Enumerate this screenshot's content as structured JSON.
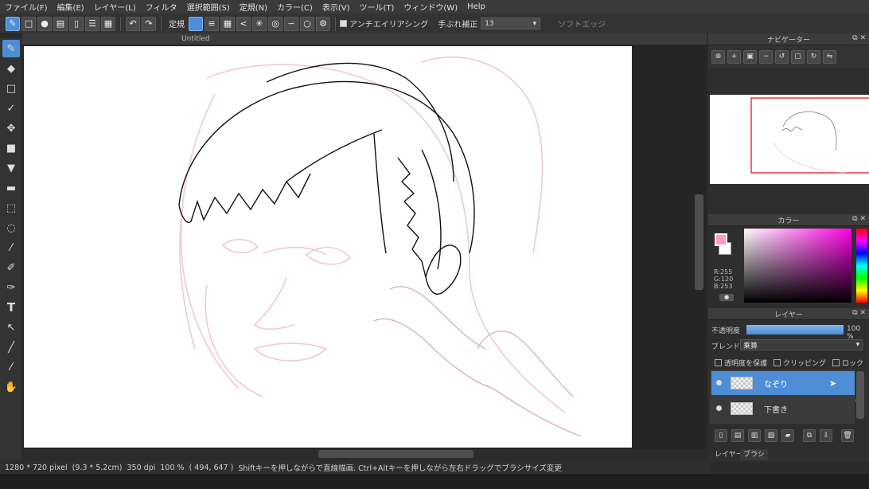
{
  "menu": [
    "ファイル(F)",
    "編集(E)",
    "レイヤー(L)",
    "フィルタ",
    "選択範囲(S)",
    "定規(N)",
    "カラー(C)",
    "表示(V)",
    "ツール(T)",
    "ウィンドウ(W)",
    "Help"
  ],
  "toolbar": {
    "ruler_label": "定規",
    "antialias_label": "アンチエイリアシング",
    "stabilizer_label": "手ぶれ補正",
    "stabilizer_value": "13",
    "soft_edge_label": "ソフトエッジ"
  },
  "document": {
    "tab_title": "Untitled"
  },
  "status": {
    "size": "1280 * 720 pixel",
    "size_cm": "(9.3 * 5.2cm)",
    "dpi": "350 dpi",
    "zoom": "100 %",
    "coords": "( 494, 647 )",
    "hint": "Shiftキーを押しながらで直線描画. Ctrl+Altキーを押しながら左右ドラッグでブラシサイズ変更"
  },
  "navigator": {
    "title": "ナビゲーター"
  },
  "color": {
    "title": "カラー",
    "r": "R:255",
    "g": "G:120",
    "b": "B:253",
    "fg_color": "#ff9ac8",
    "accent": "#4d8ed6"
  },
  "layers": {
    "title": "レイヤー",
    "opacity_label": "不透明度",
    "opacity_value": "100 %",
    "opacity": 100,
    "blend_label": "ブレンド",
    "blend_value": "乗算",
    "protect_alpha": "透明度を保護",
    "clipping": "クリッピング",
    "lock": "ロック",
    "items": [
      {
        "name": "なぞり",
        "selected": true
      },
      {
        "name": "下書き",
        "selected": false
      }
    ]
  },
  "bottom_tabs": [
    "レイヤー",
    "ブラシ"
  ]
}
